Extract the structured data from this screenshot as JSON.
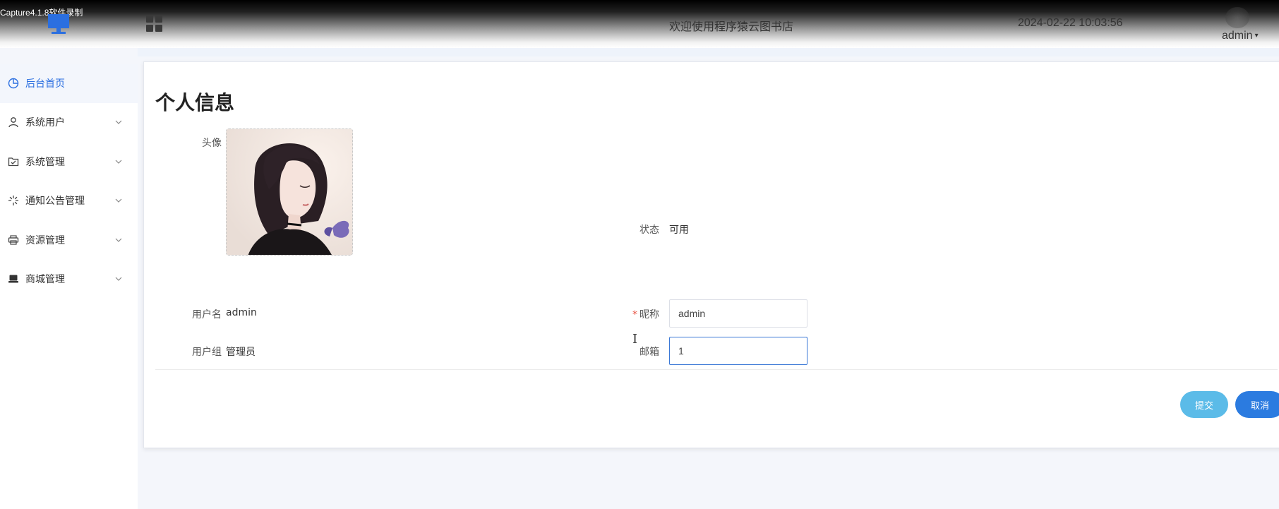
{
  "watermark": "Capture4.1.8软件录制",
  "header": {
    "welcome": "欢迎使用程序猿云图书店",
    "datetime": "2024-02-22 10:03:56",
    "user": "admin"
  },
  "sidebar": {
    "items": [
      {
        "label": "后台首页",
        "icon": "pie-chart-icon",
        "active": true
      },
      {
        "label": "系统用户",
        "icon": "user-icon"
      },
      {
        "label": "系统管理",
        "icon": "folder-check-icon"
      },
      {
        "label": "通知公告管理",
        "icon": "loading-icon"
      },
      {
        "label": "资源管理",
        "icon": "printer-icon"
      },
      {
        "label": "商城管理",
        "icon": "laptop-icon"
      }
    ]
  },
  "profile": {
    "title": "个人信息",
    "avatar_label": "头像",
    "status_label": "状态",
    "status_value": "可用",
    "username_label": "用户名",
    "username_value": "admin",
    "nickname_label": "昵称",
    "nickname_value": "admin",
    "group_label": "用户组",
    "group_value": "管理员",
    "email_label": "邮箱",
    "email_value": "1",
    "submit_label": "提交",
    "cancel_label": "取消"
  },
  "colors": {
    "accent": "#2b6fe0",
    "submit": "#5bbbe8",
    "cancel": "#2b7be0",
    "required": "#e74c3c"
  }
}
